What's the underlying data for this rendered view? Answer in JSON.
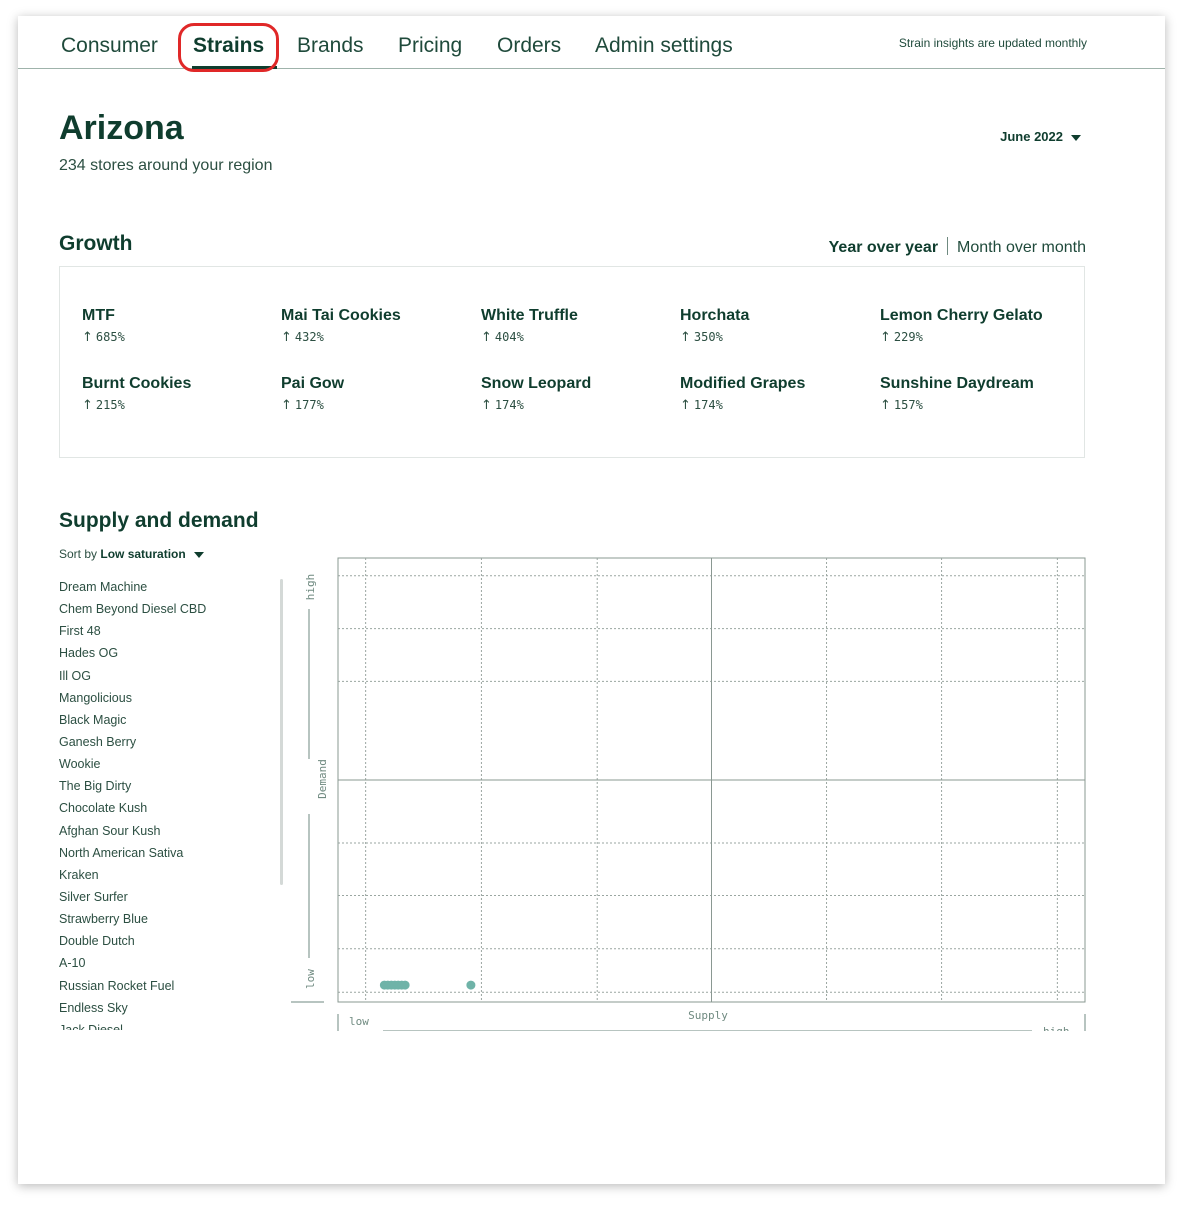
{
  "nav": {
    "items": [
      "Consumer",
      "Strains",
      "Brands",
      "Pricing",
      "Orders",
      "Admin settings"
    ],
    "active": "Strains",
    "note": "Strain insights are updated monthly"
  },
  "header": {
    "title": "Arizona",
    "subtitle": "234 stores around your region",
    "month": "June 2022"
  },
  "growth": {
    "title": "Growth",
    "toggle": {
      "active": "Year over year",
      "inactive": "Month over month"
    },
    "items": [
      {
        "name": "MTF",
        "pct": "685%"
      },
      {
        "name": "Mai Tai Cookies",
        "pct": "432%"
      },
      {
        "name": "White Truffle",
        "pct": "404%"
      },
      {
        "name": "Horchata",
        "pct": "350%"
      },
      {
        "name": "Lemon Cherry Gelato",
        "pct": "229%"
      },
      {
        "name": "Burnt Cookies",
        "pct": "215%"
      },
      {
        "name": "Pai Gow",
        "pct": "177%"
      },
      {
        "name": "Snow Leopard",
        "pct": "174%"
      },
      {
        "name": "Modified Grapes",
        "pct": "174%"
      },
      {
        "name": "Sunshine Daydream",
        "pct": "157%"
      }
    ],
    "arrow": "↑"
  },
  "supply": {
    "title": "Supply and demand",
    "sort_label": "Sort by",
    "sort_value": "Low saturation",
    "strains": [
      "Dream Machine",
      "Chem Beyond Diesel CBD",
      "First 48",
      "Hades OG",
      "Ill OG",
      "Mangolicious",
      "Black Magic",
      "Ganesh Berry",
      "Wookie",
      "The Big Dirty",
      "Chocolate Kush",
      "Afghan Sour Kush",
      "North American Sativa",
      "Kraken",
      "Silver Surfer",
      "Strawberry Blue",
      "Double Dutch",
      "A-10",
      "Russian Rocket Fuel",
      "Endless Sky",
      "Jack Diesel"
    ]
  },
  "chart_data": {
    "type": "scatter",
    "xlabel": "Supply",
    "ylabel": "Demand",
    "x_low_label": "low",
    "x_high_label": "high",
    "y_low_label": "low",
    "y_high_label": "high",
    "xlim": [
      0,
      1
    ],
    "ylim": [
      0,
      1
    ],
    "grid": true,
    "points": [
      {
        "x": 0.03,
        "y": 0.01
      },
      {
        "x": 0.035,
        "y": 0.01
      },
      {
        "x": 0.04,
        "y": 0.01
      },
      {
        "x": 0.045,
        "y": 0.01
      },
      {
        "x": 0.05,
        "y": 0.01
      },
      {
        "x": 0.055,
        "y": 0.01
      },
      {
        "x": 0.06,
        "y": 0.01
      },
      {
        "x": 0.155,
        "y": 0.01
      }
    ],
    "point_color": "#6fb3a8"
  }
}
